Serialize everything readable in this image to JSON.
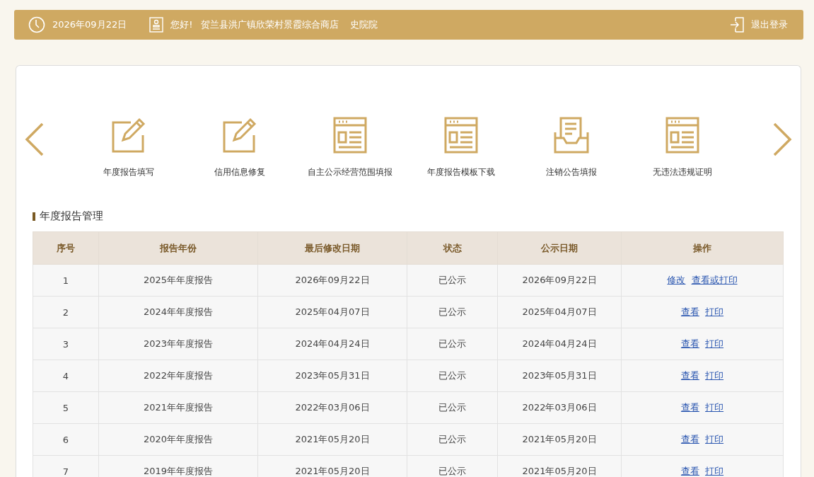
{
  "header": {
    "date": "2026年09月22日",
    "greeting": "您好!",
    "company": "贺兰县洪广镇欣荣村景霞综合商店",
    "user": "史院院",
    "logout": "退出登录"
  },
  "shortcuts": [
    {
      "label": "年度报告填写",
      "kind": "edit"
    },
    {
      "label": "信用信息修复",
      "kind": "edit"
    },
    {
      "label": "自主公示经营范围填报",
      "kind": "form"
    },
    {
      "label": "年度报告模板下载",
      "kind": "form"
    },
    {
      "label": "注销公告填报",
      "kind": "tray"
    },
    {
      "label": "无违法违规证明",
      "kind": "form"
    }
  ],
  "section_title": "年度报告管理",
  "table": {
    "columns": [
      "序号",
      "报告年份",
      "最后修改日期",
      "状态",
      "公示日期",
      "操作"
    ],
    "rows": [
      {
        "cells": [
          "1",
          "2025年年度报告",
          "2026年09月22日",
          "已公示",
          "2026年09月22日"
        ],
        "actions": [
          "修改",
          "查看或打印"
        ]
      },
      {
        "cells": [
          "2",
          "2024年年度报告",
          "2025年04月07日",
          "已公示",
          "2025年04月07日"
        ],
        "actions": [
          "查看",
          "打印"
        ]
      },
      {
        "cells": [
          "3",
          "2023年年度报告",
          "2024年04月24日",
          "已公示",
          "2024年04月24日"
        ],
        "actions": [
          "查看",
          "打印"
        ]
      },
      {
        "cells": [
          "4",
          "2022年年度报告",
          "2023年05月31日",
          "已公示",
          "2023年05月31日"
        ],
        "actions": [
          "查看",
          "打印"
        ]
      },
      {
        "cells": [
          "5",
          "2021年年度报告",
          "2022年03月06日",
          "已公示",
          "2022年03月06日"
        ],
        "actions": [
          "查看",
          "打印"
        ]
      },
      {
        "cells": [
          "6",
          "2020年年度报告",
          "2021年05月20日",
          "已公示",
          "2021年05月20日"
        ],
        "actions": [
          "查看",
          "打印"
        ]
      },
      {
        "cells": [
          "7",
          "2019年年度报告",
          "2021年05月20日",
          "已公示",
          "2021年05月20日"
        ],
        "actions": [
          "查看",
          "打印"
        ]
      }
    ]
  }
}
